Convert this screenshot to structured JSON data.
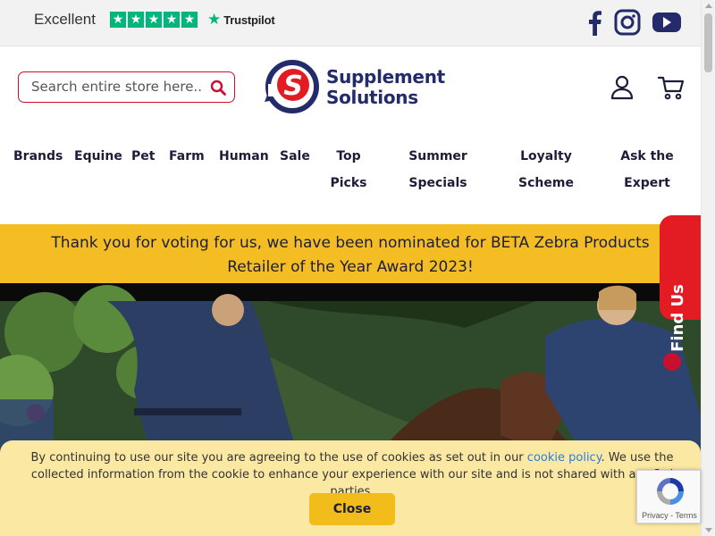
{
  "topbar": {
    "rating_label": "Excellent",
    "stars": [
      "★",
      "★",
      "★",
      "★",
      "★"
    ],
    "star_color": "#00b67a",
    "trustpilot_label": "Trustpilot",
    "social": [
      {
        "icon": "facebook-icon"
      },
      {
        "icon": "instagram-icon"
      },
      {
        "icon": "youtube-icon"
      }
    ]
  },
  "header": {
    "search_placeholder": "Search entire store here...",
    "logo_line1": "Supplement",
    "logo_line2": "Solutions",
    "brand_color": "#232b6b",
    "accent_color": "#e31b23"
  },
  "nav": {
    "items": [
      {
        "label": "Brands"
      },
      {
        "label": "Equine"
      },
      {
        "label": "Pet"
      },
      {
        "label": "Farm"
      },
      {
        "label": "Human"
      },
      {
        "label": "Sale"
      },
      {
        "line1": "Top",
        "line2": "Picks"
      },
      {
        "line1": "Summer",
        "line2": "Specials"
      },
      {
        "line1": "Loyalty",
        "line2": "Scheme"
      },
      {
        "line1": "Ask the",
        "line2": "Expert"
      }
    ]
  },
  "banner": {
    "line1": "Thank you for voting for us, we have been nominated for BETA Zebra Products",
    "line2": "Retailer of the Year Award 2023!",
    "color": "#f5bd24"
  },
  "find_us": {
    "label": "Find Us"
  },
  "cookie": {
    "text_before": "By continuing to use our site you are agreeing to the use of cookies as set out in our ",
    "link": "cookie policy",
    "text_after": ". We use the collected information from the cookie to enhance your experience with our site and is not shared with any 3rd parties.",
    "close_label": "Close"
  },
  "recaptcha": {
    "terms": "Privacy - Terms"
  }
}
